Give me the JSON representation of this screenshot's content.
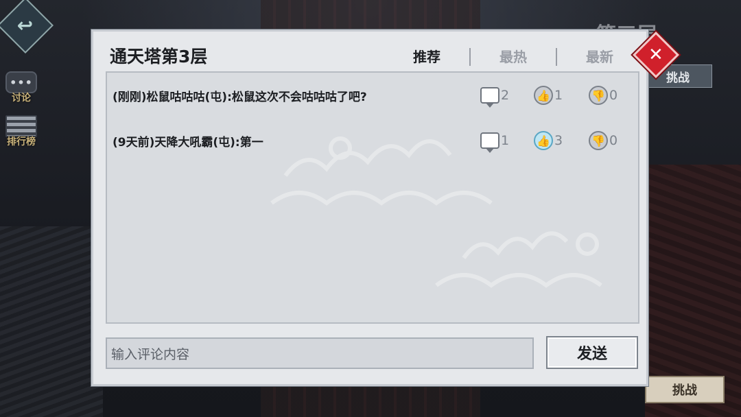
{
  "background": {
    "floor_label": "第三层",
    "challenge_top": "挑战",
    "challenge_bottom": "挑战"
  },
  "side_menu": [
    {
      "id": "discuss",
      "label": "讨论",
      "glyph": "•••"
    },
    {
      "id": "rank",
      "label": "排行榜",
      "glyph": ""
    }
  ],
  "dialog": {
    "title": "通天塔第3层",
    "tabs": [
      {
        "label": "推荐",
        "active": true
      },
      {
        "label": "最热",
        "active": false
      },
      {
        "label": "最新",
        "active": false
      }
    ],
    "close_glyph": "✕",
    "comments": [
      {
        "text": "(刚刚)松鼠咕咕咕(屯):松鼠这次不会咕咕咕了吧?",
        "replies": "2",
        "likes": "1",
        "dislikes": "0",
        "liked": false
      },
      {
        "text": "(9天前)天降大吼霸(屯):第一",
        "replies": "1",
        "likes": "3",
        "dislikes": "0",
        "liked": true
      }
    ],
    "input_placeholder": "输入评论内容",
    "send_label": "发送"
  },
  "icons": {
    "back": "back-arrow-icon",
    "comment": "comment-bubble-icon",
    "like": "thumbs-up-icon",
    "dislike": "thumbs-down-icon",
    "close": "close-icon"
  },
  "colors": {
    "close_red": "#d0202b",
    "liked_blue": "#5aa6c4",
    "side_label_gold": "#c9b27a"
  }
}
